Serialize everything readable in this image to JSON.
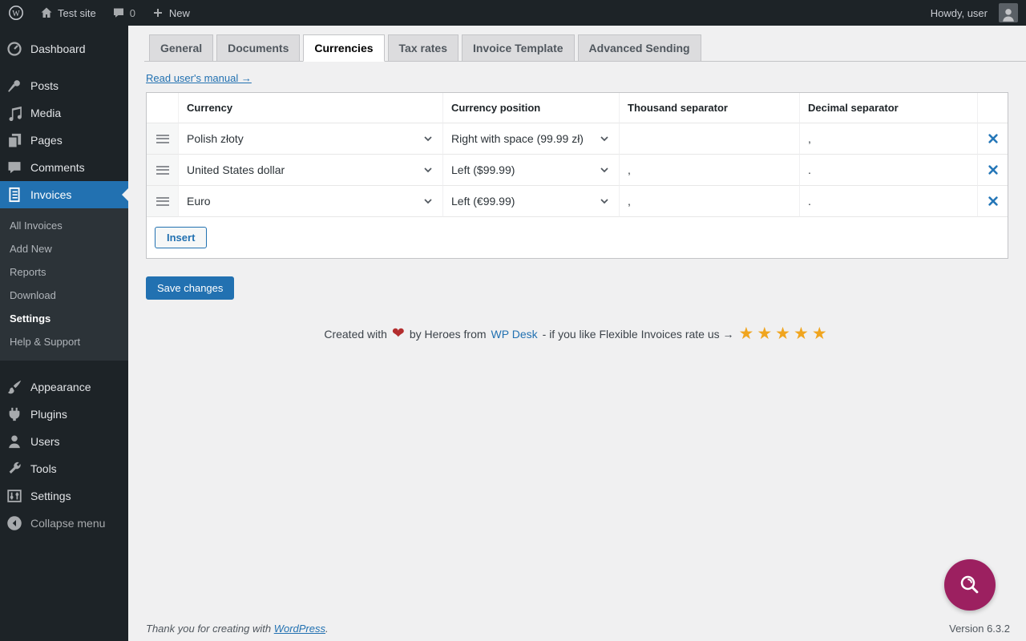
{
  "admin_bar": {
    "site_name": "Test site",
    "comments_count": "0",
    "new_label": "New",
    "howdy": "Howdy, user"
  },
  "sidebar": {
    "items": [
      {
        "label": "Dashboard",
        "icon": "dashboard-icon"
      },
      {
        "label": "Posts",
        "icon": "pin-icon"
      },
      {
        "label": "Media",
        "icon": "media-icon"
      },
      {
        "label": "Pages",
        "icon": "pages-icon"
      },
      {
        "label": "Comments",
        "icon": "comment-icon"
      },
      {
        "label": "Invoices",
        "icon": "invoice-icon",
        "active": true
      },
      {
        "label": "Appearance",
        "icon": "appearance-icon"
      },
      {
        "label": "Plugins",
        "icon": "plugin-icon"
      },
      {
        "label": "Users",
        "icon": "user-icon"
      },
      {
        "label": "Tools",
        "icon": "tools-icon"
      },
      {
        "label": "Settings",
        "icon": "settings-icon"
      },
      {
        "label": "Collapse menu",
        "icon": "collapse-icon"
      }
    ],
    "invoices_submenu": [
      "All Invoices",
      "Add New",
      "Reports",
      "Download",
      "Settings",
      "Help & Support"
    ],
    "current_submenu_item": "Settings"
  },
  "tabs": {
    "items": [
      "General",
      "Documents",
      "Currencies",
      "Tax rates",
      "Invoice Template",
      "Advanced Sending"
    ],
    "active": "Currencies"
  },
  "content": {
    "manual_link": "Read user's manual →"
  },
  "table": {
    "headers": [
      "Currency",
      "Currency position",
      "Thousand separator",
      "Decimal separator"
    ],
    "rows": [
      {
        "currency": "Polish złoty",
        "position": "Right with space (99.99 zł)",
        "thousand": "",
        "decimal": ","
      },
      {
        "currency": "United States dollar",
        "position": "Left ($99.99)",
        "thousand": ",",
        "decimal": "."
      },
      {
        "currency": "Euro",
        "position": "Left (€99.99)",
        "thousand": ",",
        "decimal": "."
      }
    ],
    "insert_label": "Insert"
  },
  "actions": {
    "save_label": "Save changes"
  },
  "promo": {
    "created_with": "Created with",
    "heart": "❤",
    "by": "by Heroes from",
    "link": "WP Desk",
    "rate": "- if you like Flexible Invoices rate us →",
    "stars": "★★★★★"
  },
  "footer": {
    "thanks": "Thank you for creating with",
    "wp_link": "WordPress",
    "period": ".",
    "version": "Version 6.3.2"
  },
  "colors": {
    "accent": "#2271b1",
    "admin_bar_bg": "#1d2327",
    "submenu_bg": "#2c3338",
    "page_bg": "#f0f0f1",
    "star": "#f0a51f",
    "heart": "#b32d2e",
    "help_button": "#9c2060"
  }
}
